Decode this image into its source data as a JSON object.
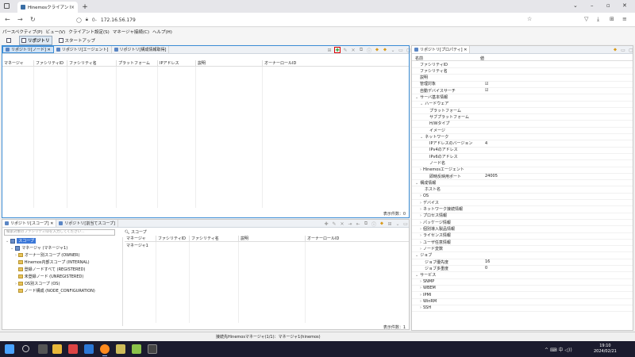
{
  "browser": {
    "tab_title": "Hinemosクライアント",
    "url": "172.16.56.179",
    "url_prefix": "0-"
  },
  "menu": [
    "パースペクティブ(P)",
    "ビュー(V)",
    "クライアント設定(S)",
    "マネージャ接続(C)",
    "ヘルプ(H)"
  ],
  "perspectives": [
    {
      "label": "リポジトリ",
      "active": true
    },
    {
      "label": "スタートアップ",
      "active": false
    }
  ],
  "node_panel": {
    "tabs": [
      "リポジトリ[ノード]",
      "リポジトリ[エージェント]",
      "リポジトリ[構成情報取得]"
    ],
    "columns": [
      "マネージャ",
      "ファシリティID",
      "ファシリティ名",
      "プラットフォーム",
      "IPアドレス",
      "説明",
      "オーナーロールID"
    ],
    "footer": "表示件数：0"
  },
  "scope_panel": {
    "tabs": [
      "リポジトリ[スコープ]",
      "リポジトリ[割当てスコープ]"
    ],
    "search_placeholder": "検索対象のファシリティIDを入力してください...",
    "tree": [
      {
        "label": "スコープ",
        "level": 0,
        "selected": true
      },
      {
        "label": "マネージャ (マネージャ1)",
        "level": 1
      },
      {
        "label": "オーナー別スコープ (OWNER)",
        "level": 2
      },
      {
        "label": "Hinemos内部スコープ (INTERNAL)",
        "level": 2
      },
      {
        "label": "登録ノードすべて (REGISTERED)",
        "level": 2
      },
      {
        "label": "未登録ノード (UNREGISTERED)",
        "level": 2
      },
      {
        "label": "OS別スコープ (OS)",
        "level": 2
      },
      {
        "label": "ノード構成 (NODE_CONFIGURATION)",
        "level": 2
      }
    ],
    "right_header": "スコープ",
    "columns": [
      "マネージャ",
      "ファシリティID",
      "ファシリティ名",
      "説明",
      "オーナーロールID"
    ],
    "first_cell": "マネージャ1",
    "footer": "表示件数：1"
  },
  "property_panel": {
    "tab": "リポジトリ[プロパティ]",
    "col_name": "名前",
    "col_value": "値",
    "rows": [
      {
        "name": "ファシリティID",
        "value": "",
        "indent": 1
      },
      {
        "name": "ファシリティ名",
        "value": "",
        "indent": 1
      },
      {
        "name": "説明",
        "value": "",
        "indent": 1
      },
      {
        "name": "管理対象",
        "value": "☑",
        "indent": 1
      },
      {
        "name": "自動デバイスサーチ",
        "value": "☑",
        "indent": 1
      },
      {
        "name": "サーバ基本情報",
        "value": "",
        "indent": 0,
        "caret": "⌄"
      },
      {
        "name": "ハードウェア",
        "value": "",
        "indent": 1,
        "caret": "⌄"
      },
      {
        "name": "プラットフォーム",
        "value": "",
        "indent": 3
      },
      {
        "name": "サブプラットフォーム",
        "value": "",
        "indent": 3
      },
      {
        "name": "H/Wタイプ",
        "value": "",
        "indent": 3
      },
      {
        "name": "イメージ",
        "value": "",
        "indent": 3
      },
      {
        "name": "ネットワーク",
        "value": "",
        "indent": 1,
        "caret": "⌄"
      },
      {
        "name": "IPアドレスのバージョン",
        "value": "4",
        "indent": 3
      },
      {
        "name": "IPv4のアドレス",
        "value": "",
        "indent": 3
      },
      {
        "name": "IPv6のアドレス",
        "value": "",
        "indent": 3
      },
      {
        "name": "ノード名",
        "value": "",
        "indent": 3
      },
      {
        "name": "Hinemosエージェント",
        "value": "",
        "indent": 1,
        "caret": "›"
      },
      {
        "name": "即時反映用ポート",
        "value": "24005",
        "indent": 3
      },
      {
        "name": "構成情報",
        "value": "",
        "indent": 0,
        "caret": "⌄"
      },
      {
        "name": "ホスト名",
        "value": "",
        "indent": 2
      },
      {
        "name": "OS",
        "value": "",
        "indent": 1,
        "caret": "›"
      },
      {
        "name": "デバイス",
        "value": "",
        "indent": 1,
        "caret": "›"
      },
      {
        "name": "ネットワーク接続情報",
        "value": "",
        "indent": 1,
        "caret": "›"
      },
      {
        "name": "プロセス情報",
        "value": "",
        "indent": 1,
        "caret": "›"
      },
      {
        "name": "パッケージ情報",
        "value": "",
        "indent": 1,
        "caret": "›"
      },
      {
        "name": "個別導入製品情報",
        "value": "",
        "indent": 1,
        "caret": "›"
      },
      {
        "name": "ライセンス情報",
        "value": "",
        "indent": 1,
        "caret": "›"
      },
      {
        "name": "ユーザ任意情報",
        "value": "",
        "indent": 1,
        "caret": "›"
      },
      {
        "name": "ノード変数",
        "value": "",
        "indent": 1,
        "caret": "›"
      },
      {
        "name": "ジョブ",
        "value": "",
        "indent": 0,
        "caret": "⌄"
      },
      {
        "name": "ジョブ優先度",
        "value": "16",
        "indent": 2
      },
      {
        "name": "ジョブ多重度",
        "value": "0",
        "indent": 2
      },
      {
        "name": "サービス",
        "value": "",
        "indent": 0,
        "caret": "⌄"
      },
      {
        "name": "SNMP",
        "value": "",
        "indent": 1,
        "caret": "›"
      },
      {
        "name": "WBEM",
        "value": "",
        "indent": 1,
        "caret": "›"
      },
      {
        "name": "IPMI",
        "value": "",
        "indent": 1,
        "caret": "›"
      },
      {
        "name": "WinRM",
        "value": "",
        "indent": 1,
        "caret": "›"
      },
      {
        "name": "SSH",
        "value": "",
        "indent": 1,
        "caret": "›"
      }
    ]
  },
  "status": "接続先Hinemosマネージャ(1/1)：マネージャ1(hinemos)",
  "clock": {
    "time": "19:10",
    "date": "2024/02/21"
  },
  "taskbar_tray": "^ ⌨ 中 ◁))"
}
